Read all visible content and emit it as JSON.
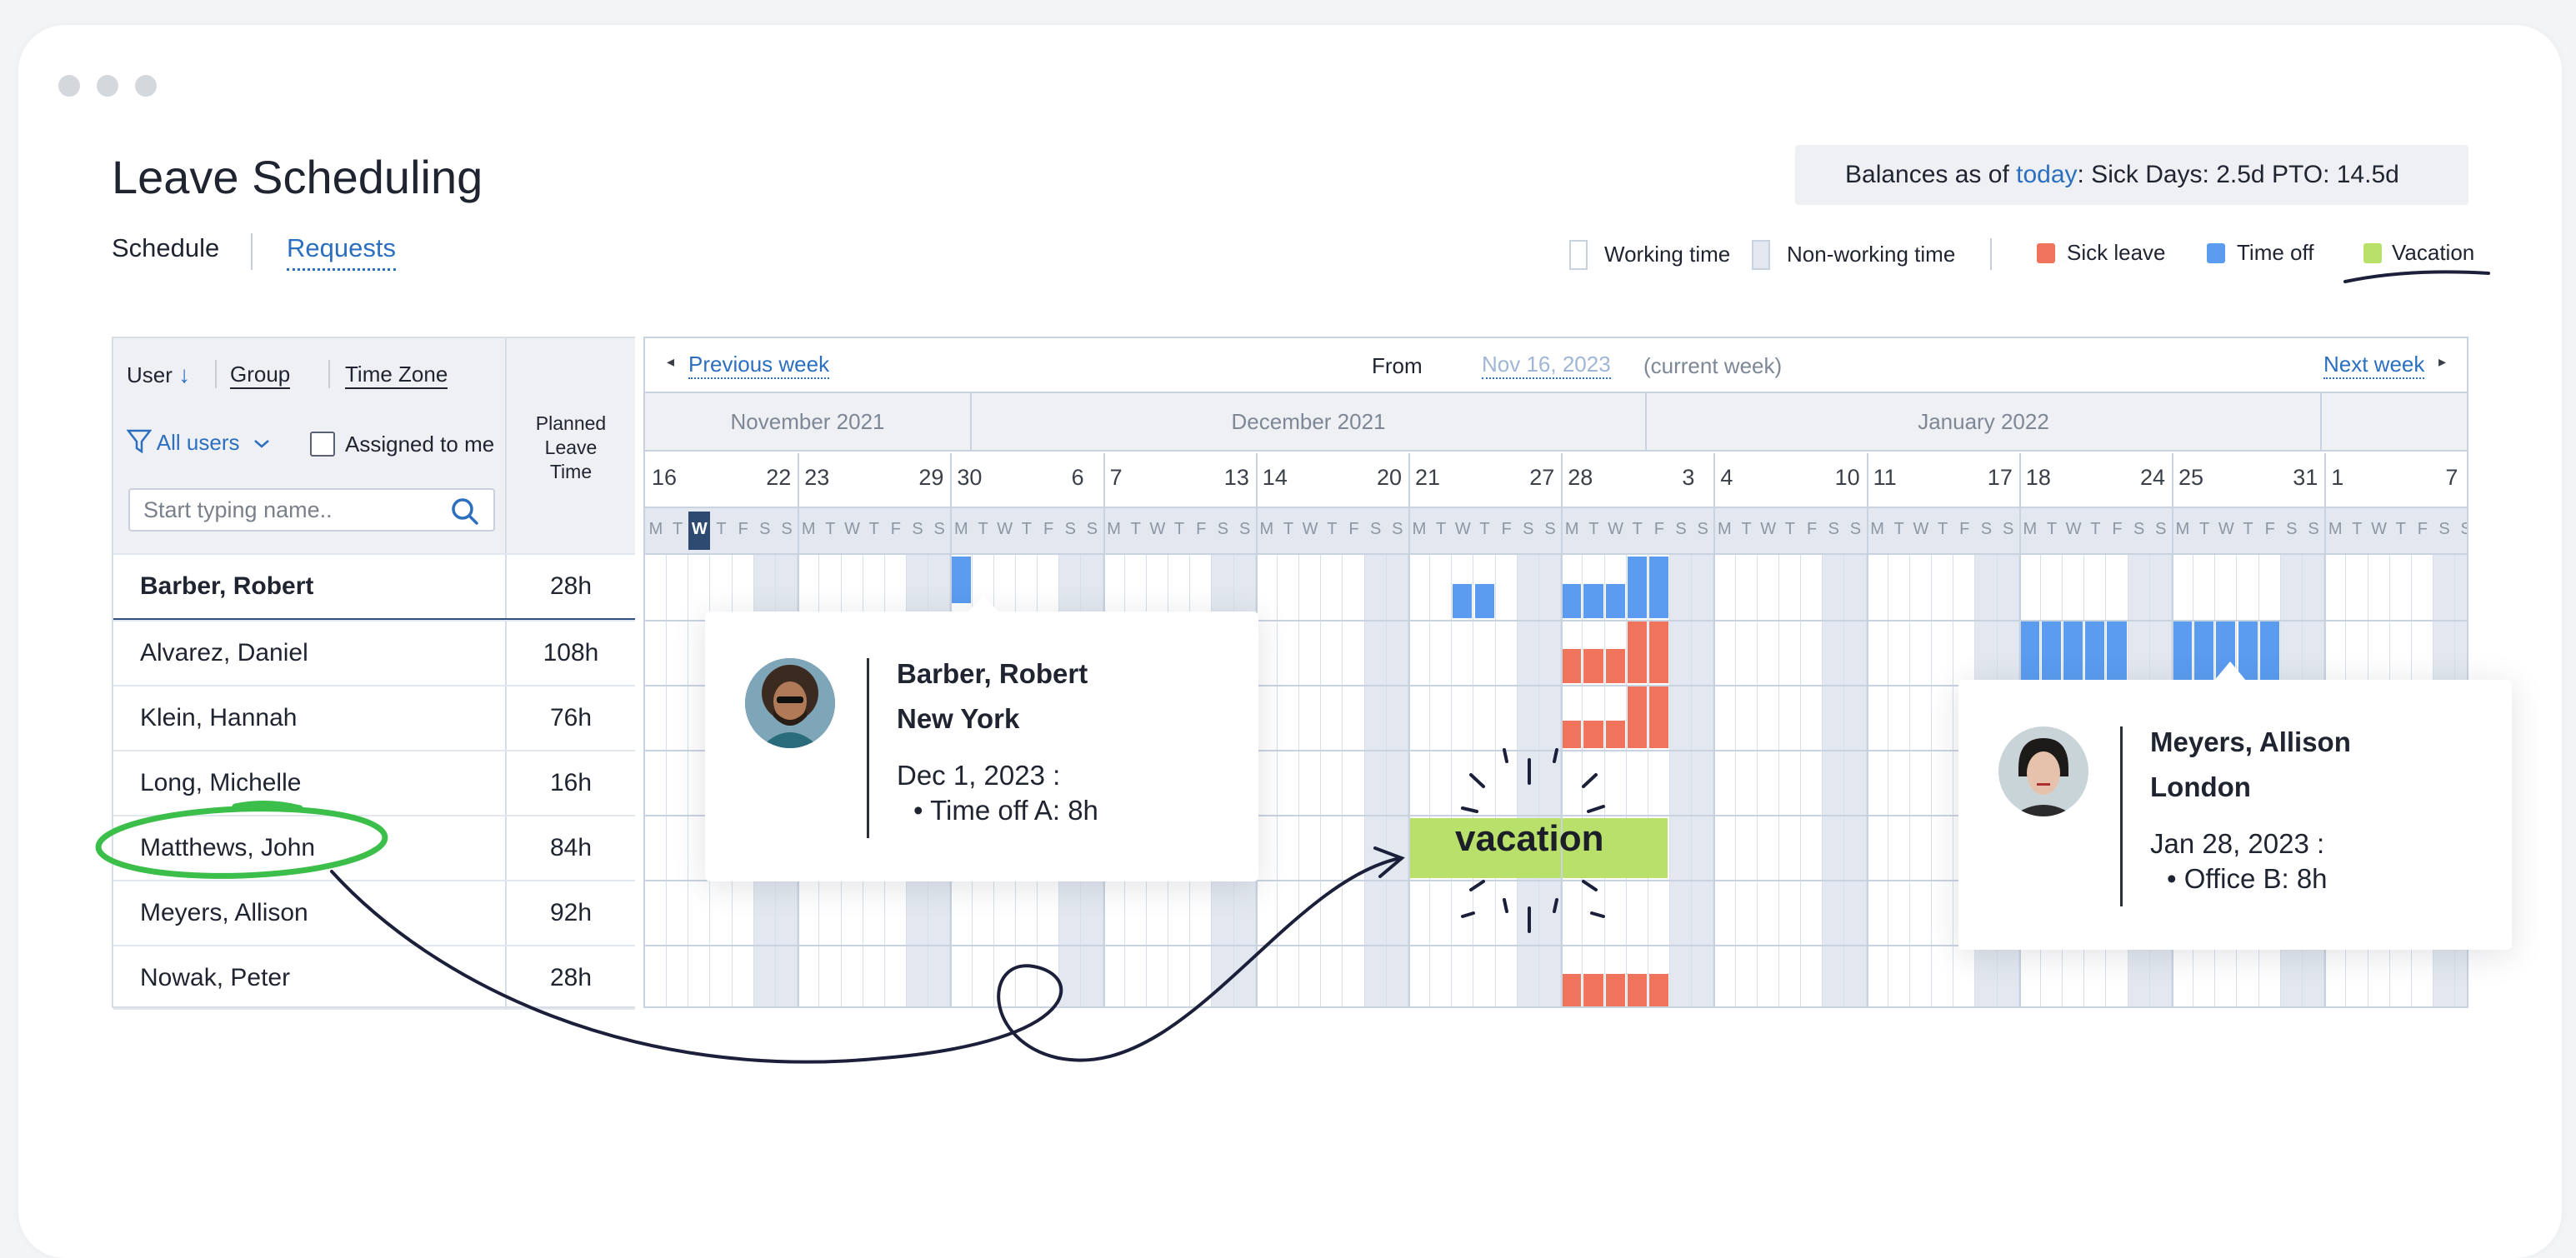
{
  "page": {
    "title": "Leave Scheduling",
    "tabs": {
      "schedule": "Schedule",
      "requests": "Requests"
    }
  },
  "balances": {
    "prefix": "Balances as of ",
    "today": "today",
    "rest": ":  Sick Days: 2.5d   PTO: 14.5d"
  },
  "legend": {
    "working": "Working time",
    "nonworking": "Non-working time",
    "sick": "Sick leave",
    "timeoff": "Time off",
    "vacation": "Vacation"
  },
  "colors": {
    "sick": "#f0735c",
    "timeoff": "#5b9cf0",
    "vacation": "#b8e06a",
    "accent": "#2c6fbf",
    "nonworking": "#e3e8f0"
  },
  "left": {
    "user": "User",
    "group": "Group",
    "timezone": "Time Zone",
    "all_users": "All users",
    "assigned": "Assigned to me",
    "search_placeholder": "Start typing name..",
    "planned_l1": "Planned",
    "planned_l2": "Leave",
    "planned_l3": "Time"
  },
  "rows": [
    {
      "name": "Barber, Robert",
      "hours": "28h"
    },
    {
      "name": "Alvarez, Daniel",
      "hours": "108h"
    },
    {
      "name": "Klein, Hannah",
      "hours": "76h"
    },
    {
      "name": "Long, Michelle",
      "hours": "16h"
    },
    {
      "name": "Matthews, John",
      "hours": "84h"
    },
    {
      "name": "Meyers, Allison",
      "hours": "92h"
    },
    {
      "name": "Nowak, Peter",
      "hours": "28h"
    }
  ],
  "nav": {
    "prev": "Previous week",
    "from_label": "From",
    "from_date": "Nov 16, 2023",
    "current": "(current week)",
    "next": "Next week"
  },
  "months": [
    "November 2021",
    "December 2021",
    "January 2022"
  ],
  "week_starts": [
    "16",
    "23",
    "30",
    "7",
    "14",
    "21",
    "28",
    "4",
    "11",
    "18",
    "25",
    "1"
  ],
  "week_ends": [
    "22",
    "29",
    "6",
    "13",
    "20",
    "27",
    "3",
    "10",
    "17",
    "24",
    "31",
    "7"
  ],
  "day_letters": [
    "M",
    "T",
    "W",
    "T",
    "F",
    "S",
    "S"
  ],
  "popup1": {
    "name": "Barber, Robert",
    "city": "New York",
    "date": "Dec 1, 2023 :",
    "item": "•  Time off A: 8h"
  },
  "popup2": {
    "name": "Meyers, Allison",
    "city": "London",
    "date": "Jan 28, 2023 :",
    "item": "•  Office B: 8h"
  },
  "vacation_label": "vacation"
}
